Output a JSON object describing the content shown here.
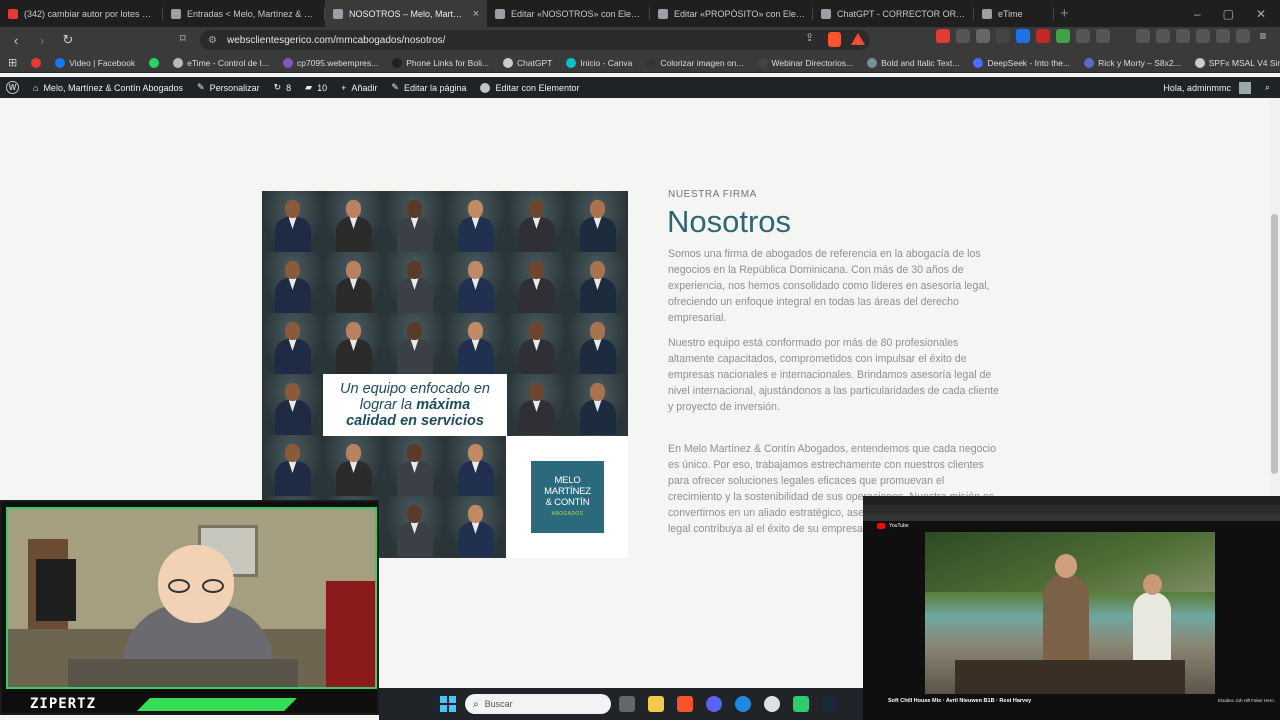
{
  "browser": {
    "tabs": [
      {
        "title": "(342) cambiar autor por lotes wordp",
        "fav": "#e53935",
        "active": false
      },
      {
        "title": "Entradas < Melo, Martínez & Contín",
        "fav": "#9aa0a6",
        "active": false
      },
      {
        "title": "NOSOTROS – Melo, Martínez &",
        "fav": "#9aa0a6",
        "active": true
      },
      {
        "title": "Editar «NOSOTROS» con Elementor",
        "fav": "#9aa0a6",
        "active": false
      },
      {
        "title": "Editar «PROPÓSITO» con Elementor",
        "fav": "#9aa0a6",
        "active": false
      },
      {
        "title": "ChatGPT - CORRECTOR ORTOGRÁFIC",
        "fav": "#9aa0a6",
        "active": false
      },
      {
        "title": "eTime",
        "fav": "#9aa0a6",
        "active": false
      }
    ],
    "close_glyph": "×",
    "new_tab_glyph": "+",
    "window_controls": [
      "–",
      "▢",
      "✕"
    ],
    "url": "websclientesgerico.com/mmcabogados/nosotros/",
    "bookmarks": [
      {
        "label": "",
        "color": "#e53935"
      },
      {
        "label": "Video | Facebook",
        "color": "#1877f2"
      },
      {
        "label": "",
        "color": "#25d366"
      },
      {
        "label": "eTime - Control de I...",
        "color": "#bbbbbb"
      },
      {
        "label": "cp7095.webempres...",
        "color": "#7e57c2"
      },
      {
        "label": "Phone Links for Boli...",
        "color": "#222222"
      },
      {
        "label": "ChatGPT",
        "color": "#cccccc"
      },
      {
        "label": "Inicio - Canva",
        "color": "#00c4cc"
      },
      {
        "label": "Colorizar imagen on...",
        "color": "#333333"
      },
      {
        "label": "Webinar Directorios...",
        "color": "#444444"
      },
      {
        "label": "Bold and Italic Text...",
        "color": "#78909c"
      },
      {
        "label": "DeepSeek - Into the...",
        "color": "#4d6bfe"
      },
      {
        "label": "Rick y Morty – S8x2...",
        "color": "#5c6bc0"
      },
      {
        "label": "SPFx MSAL V4 Singl...",
        "color": "#cccccc"
      }
    ]
  },
  "wpbar": {
    "site": "Melo, Martínez & Contín Abogados",
    "customize": "Personalizar",
    "updates": "8",
    "comments": "10",
    "add_new": "Añadir",
    "edit_page": "Editar la página",
    "elementor": "Editar con Elementor",
    "greeting": "Hola, adminmmc"
  },
  "content": {
    "slogan_line1": "Un equipo enfocado en",
    "slogan_line2_a": "lograr la ",
    "slogan_line2_b": "máxima",
    "slogan_line3": "calidad en servicios",
    "logo_line1": "MELO",
    "logo_line2": "MARTÍNEZ",
    "logo_line3": "& CONTÍN",
    "logo_line4": "ABOGADOS",
    "eyebrow": "NUESTRA FIRMA",
    "title": "Nosotros",
    "para1": "Somos una firma de abogados de referencia en la abogacía de los negocios en la República Dominicana. Con más de 30 años de experiencia, nos hemos consolidado como líderes en asesoría legal, ofreciendo un enfoque integral en todas las áreas del derecho empresarial.",
    "para2": "Nuestro equipo está conformado por más de 80 profesionales altamente capacitados, comprometidos con impulsar el éxito de empresas nacionales e internacionales. Brindamos asesoría legal de nivel internacional, ajustándonos a las particularidades de cada cliente y proyecto de inversión.",
    "para3": "En Melo Martínez & Contín Abogados, entendemos que cada negocio es único. Por eso, trabajamos estrechamente con nuestros clientes para ofrecer soluciones legales eficaces que promuevan el crecimiento y la sostenibilidad de sus operaciones. Nuestra misión es convertirnos en un aliado estratégico, asegurando que cada decisión legal contribuya al el éxito de su empresa."
  },
  "overlay": {
    "streamer": "ZIPERTZ",
    "video_title": "Soft Chill House Mix · Avril Nieuwen B1B · Rest Harvey",
    "video_side": "Eisabec Joh Hill Faker Hero.",
    "yt_label": "YouTube"
  },
  "taskbar": {
    "search_placeholder": "Buscar"
  }
}
